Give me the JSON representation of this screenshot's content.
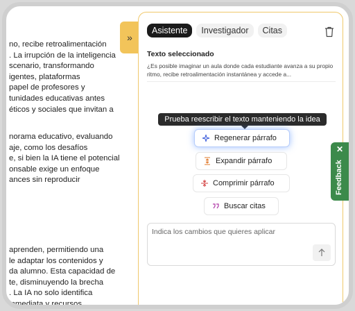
{
  "document": {
    "p1": [
      "no, recibe retroalimentación",
      ". La irrupción de la inteligencia",
      "scenario, transformando",
      "igentes, plataformas",
      "papel de profesores y",
      "tunidades educativas antes",
      "éticos y sociales que invitan a"
    ],
    "p2": [
      "norama educativo, evaluando",
      "aje, como los desafíos",
      "e, si bien la IA tiene el potencial",
      "onsable exige un enfoque",
      "ances sin reproducir"
    ],
    "p3": [
      "aprenden, permitiendo una",
      "le adaptar los contenidos y",
      "da alumno. Esta capacidad de",
      "te, disminuyendo la brecha",
      ". La IA no solo identifica",
      "inmediata y recursos"
    ]
  },
  "collapse_icon": "double-chevron-right-icon",
  "tabs": [
    "Asistente",
    "Investigador",
    "Citas"
  ],
  "active_tab": "Asistente",
  "selection": {
    "title": "Texto seleccionado",
    "text": "¿Es posible imaginar un aula donde cada estudiante avanza a su propio ritmo, recibe retroalimentación instantánea y accede a..."
  },
  "tooltip": "Prueba reescribir el texto manteniendo la idea",
  "actions": [
    {
      "label": "Regenerar párrafo",
      "icon": "sparkle-icon"
    },
    {
      "label": "Expandir párrafo",
      "icon": "expand-icon"
    },
    {
      "label": "Comprimir párrafo",
      "icon": "compress-icon"
    },
    {
      "label": "Buscar citas",
      "icon": "quote-icon"
    }
  ],
  "composer": {
    "placeholder": "Indica los cambios que quieres aplicar"
  },
  "feedback": {
    "label": "Feedback",
    "close": "✕"
  },
  "colors": {
    "accent_tab": "#f2c45a",
    "feedback_bg": "#3c8a4b",
    "glow": "#5a8cff",
    "active_tab": "#1b1b1b"
  }
}
